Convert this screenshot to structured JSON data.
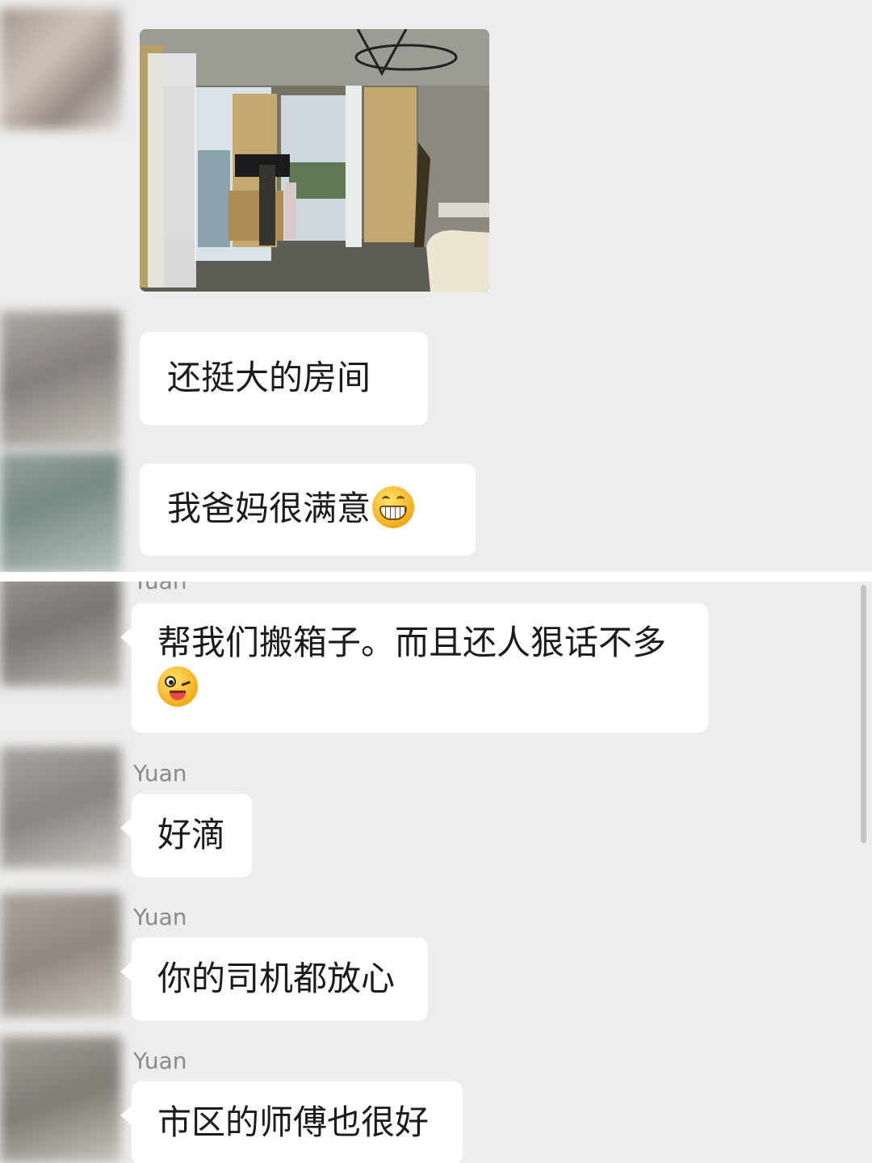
{
  "messages_top": [
    {
      "type": "image",
      "alt": ""
    },
    {
      "type": "text",
      "text": "还挺大的房间"
    },
    {
      "type": "text",
      "text": "我爸妈很满意",
      "emoji": "grinning-face-emoji"
    }
  ],
  "messages_bottom": [
    {
      "sender": "Yuan",
      "text": "帮我们搬箱子。而且还人狠话不多",
      "emoji": "winking-face-tongue-emoji"
    },
    {
      "sender": "Yuan",
      "text": "好滴"
    },
    {
      "sender": "Yuan",
      "text": "你的司机都放心"
    },
    {
      "sender": "Yuan",
      "text": "市区的师傅也很好"
    }
  ],
  "colors": {
    "background": "#ededed",
    "bubble": "#ffffff",
    "sender": "#8a8a8a",
    "text": "#1b1b1b"
  }
}
